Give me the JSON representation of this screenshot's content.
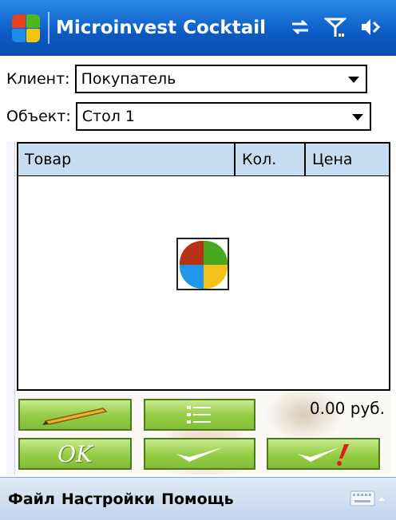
{
  "titlebar": {
    "title": "Microinvest Cocktail",
    "icons": [
      "windows-start-icon",
      "connectivity-icon",
      "signal-icon",
      "speaker-icon"
    ]
  },
  "form": {
    "client_label": "Клиент:",
    "client_value": "Покупатель",
    "object_label": "Объект:",
    "object_value": "Стол 1"
  },
  "grid": {
    "columns": [
      "Товар",
      "Кол.",
      "Цена"
    ],
    "rows": []
  },
  "total": "0.00 руб.",
  "buttons": {
    "edit_icon": "pencil-icon",
    "list_icon": "list-icon",
    "ok_label": "OK",
    "confirm_icon": "checkmark-icon",
    "confirm_alert_icon": "checkmark-exclamation-icon"
  },
  "menu": {
    "items": [
      "Файл",
      "Настройки",
      "Помощь"
    ],
    "keyboard_icon": "keyboard-icon"
  },
  "colors": {
    "titlebar": "#0b5bc4",
    "grid_header": "#c6dcf0",
    "button_green": "#93cc45",
    "menubar": "#c2d6ee"
  }
}
